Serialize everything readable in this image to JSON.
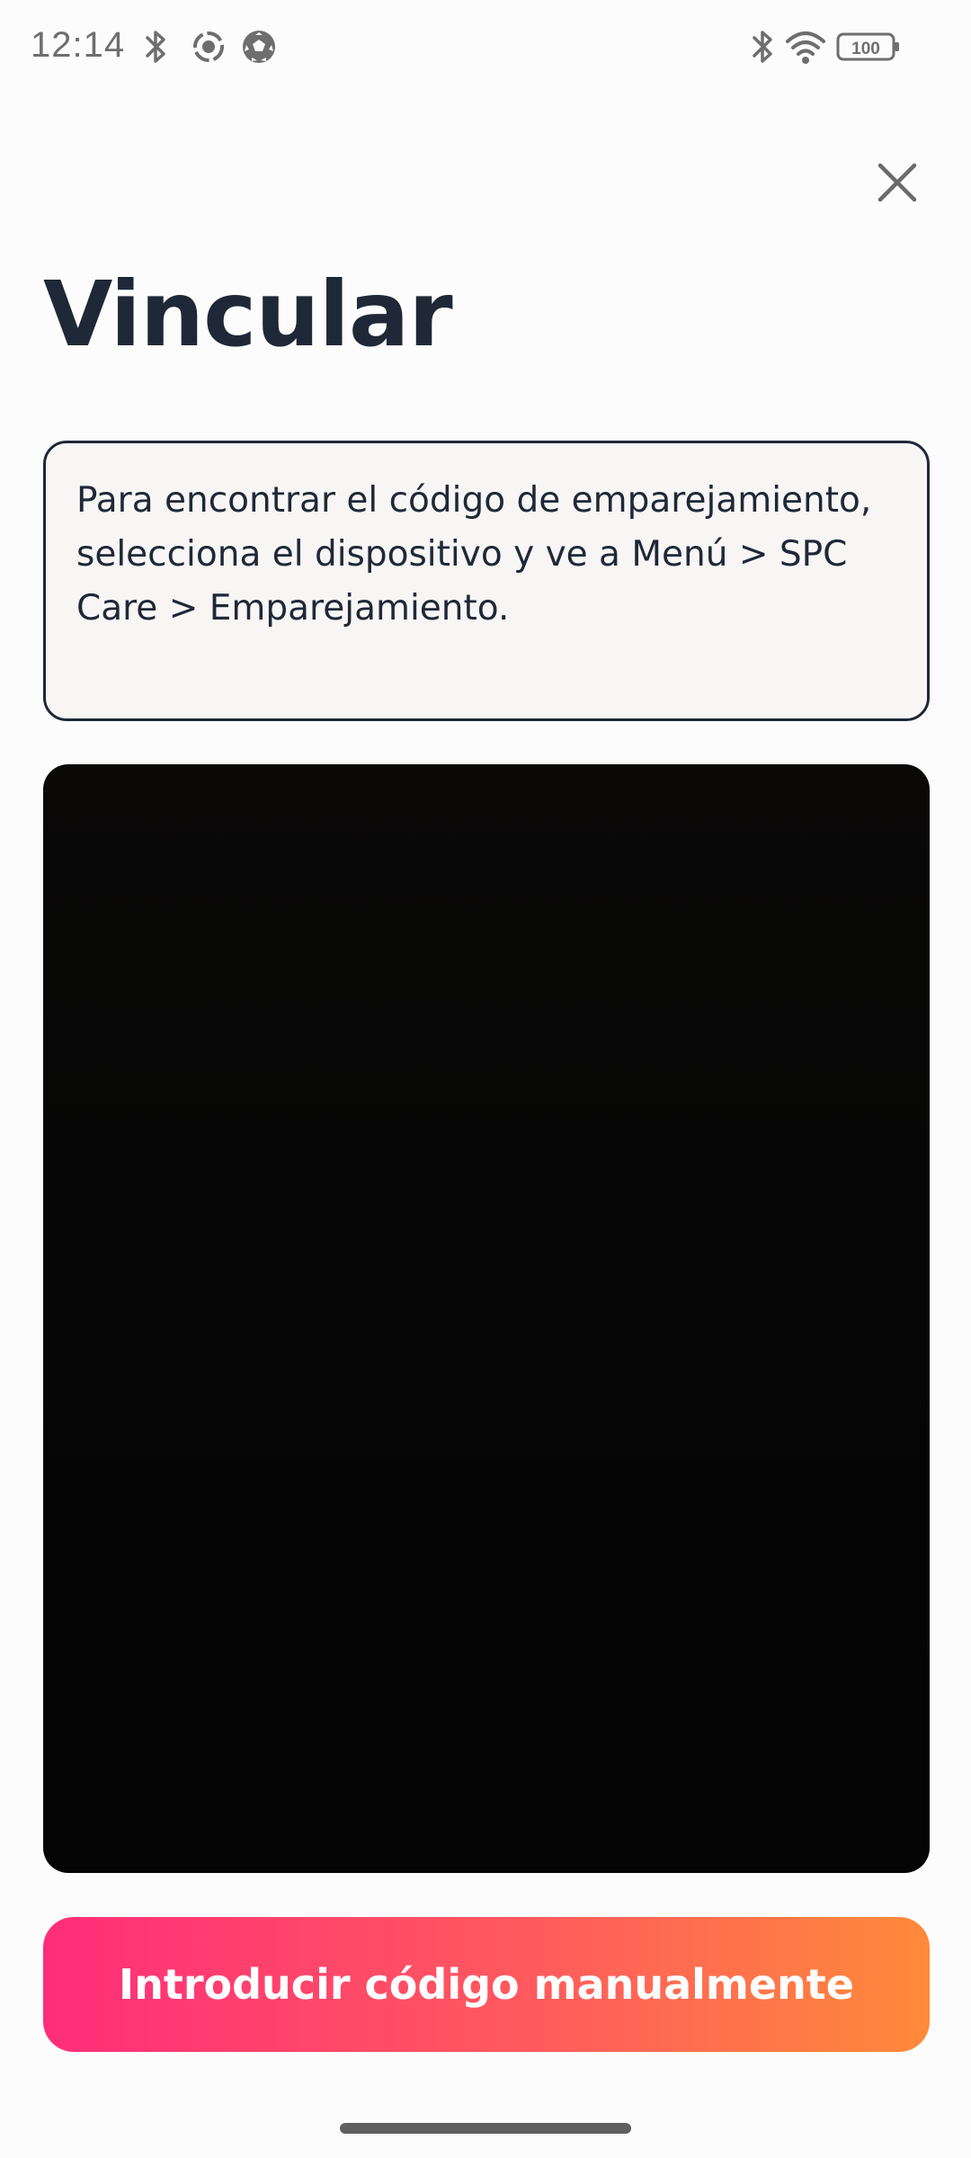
{
  "status_bar": {
    "time": "12:14",
    "left_icons": [
      "bluetooth-icon",
      "screen-record-icon",
      "soccer-ball-icon"
    ],
    "right_icons": [
      "bluetooth-icon",
      "wifi-icon",
      "battery-icon"
    ],
    "battery_level": "100"
  },
  "header": {
    "close_icon": "close-icon",
    "title": "Vincular"
  },
  "info": {
    "text": "Para encontrar el código de emparejamiento, selecciona el dispositivo y ve a Menú > SPC Care > Emparejamiento."
  },
  "actions": {
    "manual_code_label": "Introducir código manualmente"
  },
  "colors": {
    "title": "#1f2836",
    "button_gradient_start": "#ff2d7a",
    "button_gradient_end": "#ff8a3a",
    "camera_background": "#050505"
  }
}
